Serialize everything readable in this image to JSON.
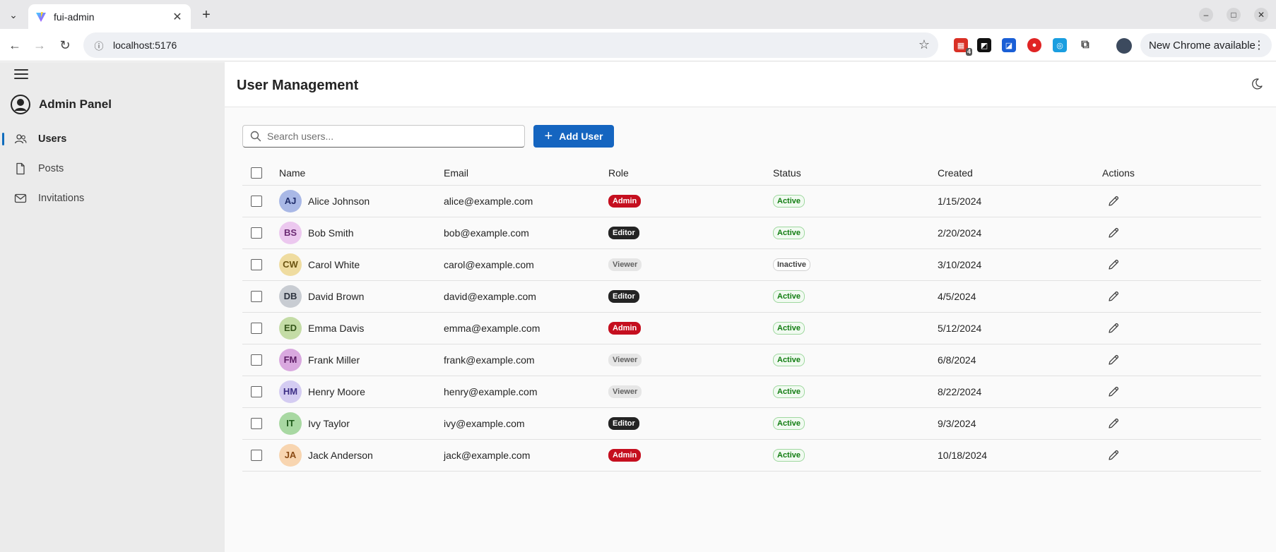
{
  "browser": {
    "tab_title": "fui-admin",
    "url": "localhost:5176",
    "extension_badge": "4",
    "update_label": "New Chrome available"
  },
  "sidebar": {
    "brand": "Admin Panel",
    "items": [
      {
        "label": "Users",
        "icon": "people-icon",
        "active": true
      },
      {
        "label": "Posts",
        "icon": "document-icon",
        "active": false
      },
      {
        "label": "Invitations",
        "icon": "mail-icon",
        "active": false
      }
    ]
  },
  "header": {
    "title": "User Management"
  },
  "toolbar": {
    "search_placeholder": "Search users...",
    "add_label": "Add User"
  },
  "table": {
    "columns": [
      "Name",
      "Email",
      "Role",
      "Status",
      "Created",
      "Actions"
    ],
    "rows": [
      {
        "initials": "AJ",
        "name": "Alice Johnson",
        "email": "alice@example.com",
        "role": "Admin",
        "status": "Active",
        "created": "1/15/2024",
        "avatar_bg": "#a9b8e6",
        "avatar_fg": "#1f2d6b"
      },
      {
        "initials": "BS",
        "name": "Bob Smith",
        "email": "bob@example.com",
        "role": "Editor",
        "status": "Active",
        "created": "2/20/2024",
        "avatar_bg": "#ecc8ef",
        "avatar_fg": "#6b2a73"
      },
      {
        "initials": "CW",
        "name": "Carol White",
        "email": "carol@example.com",
        "role": "Viewer",
        "status": "Inactive",
        "created": "3/10/2024",
        "avatar_bg": "#efdca0",
        "avatar_fg": "#6b5411"
      },
      {
        "initials": "DB",
        "name": "David Brown",
        "email": "david@example.com",
        "role": "Editor",
        "status": "Active",
        "created": "4/5/2024",
        "avatar_bg": "#c8ccd2",
        "avatar_fg": "#2e3440"
      },
      {
        "initials": "ED",
        "name": "Emma Davis",
        "email": "emma@example.com",
        "role": "Admin",
        "status": "Active",
        "created": "5/12/2024",
        "avatar_bg": "#c4dca6",
        "avatar_fg": "#35561a"
      },
      {
        "initials": "FM",
        "name": "Frank Miller",
        "email": "frank@example.com",
        "role": "Viewer",
        "status": "Active",
        "created": "6/8/2024",
        "avatar_bg": "#d9a8df",
        "avatar_fg": "#5e1d66"
      },
      {
        "initials": "HM",
        "name": "Henry Moore",
        "email": "henry@example.com",
        "role": "Viewer",
        "status": "Active",
        "created": "8/22/2024",
        "avatar_bg": "#d4ccf2",
        "avatar_fg": "#3d2f86"
      },
      {
        "initials": "IT",
        "name": "Ivy Taylor",
        "email": "ivy@example.com",
        "role": "Editor",
        "status": "Active",
        "created": "9/3/2024",
        "avatar_bg": "#a8d8a2",
        "avatar_fg": "#1e5a1a"
      },
      {
        "initials": "JA",
        "name": "Jack Anderson",
        "email": "jack@example.com",
        "role": "Admin",
        "status": "Active",
        "created": "10/18/2024",
        "avatar_bg": "#f8d5b0",
        "avatar_fg": "#8a4a14"
      }
    ]
  },
  "colors": {
    "accent": "#1565c0",
    "admin": "#c50f1f",
    "editor": "#242424",
    "active_green": "#107c10"
  }
}
